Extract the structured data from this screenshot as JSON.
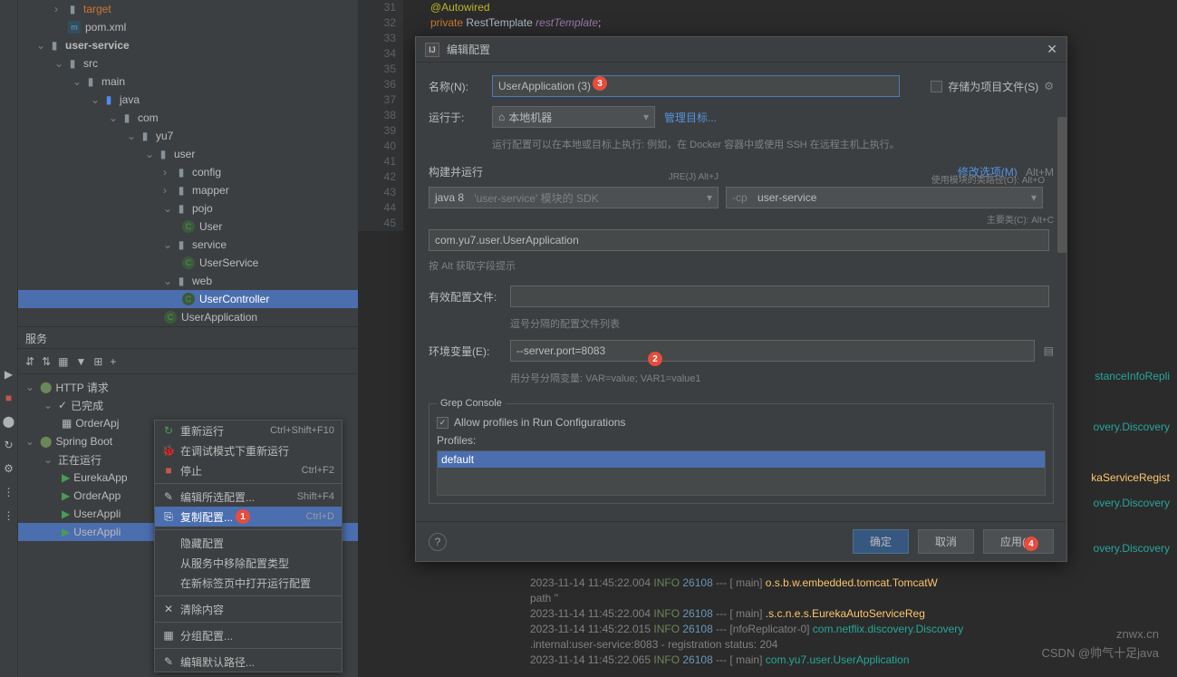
{
  "tree": {
    "target": "target",
    "pom": "pom.xml",
    "userService": "user-service",
    "src": "src",
    "main": "main",
    "java": "java",
    "com": "com",
    "yu7": "yu7",
    "user": "user",
    "config": "config",
    "mapper": "mapper",
    "pojo": "pojo",
    "userClass": "User",
    "service": "service",
    "userServiceClass": "UserService",
    "web": "web",
    "userController": "UserController",
    "userApplication": "UserApplication"
  },
  "servicesPanel": {
    "title": "服务",
    "httpRequests": "HTTP 请求",
    "completed": "已完成",
    "orderApp1": "OrderApj",
    "springBoot": "Spring Boot",
    "running": "正在运行",
    "eurekaApp": "EurekaApp",
    "orderApp2": "OrderApp",
    "userApp1": "UserAppli",
    "userApp2": "UserAppli"
  },
  "contextMenu": {
    "rerun": "重新运行",
    "rerunShortcut": "Ctrl+Shift+F10",
    "debugRerun": "在调试模式下重新运行",
    "stop": "停止",
    "stopShortcut": "Ctrl+F2",
    "editConfig": "编辑所选配置...",
    "editShortcut": "Shift+F4",
    "copyConfig": "复制配置...",
    "copyShortcut": "Ctrl+D",
    "hideConfig": "隐藏配置",
    "removeFromServices": "从服务中移除配置类型",
    "openInNewTab": "在新标签页中打开运行配置",
    "clearContent": "清除内容",
    "groupConfig": "分组配置...",
    "editDefaults": "编辑默认路径..."
  },
  "dialog": {
    "title": "编辑配置",
    "nameLabel": "名称(N):",
    "nameValue": "UserApplication (3)",
    "saveAsProject": "存储为项目文件(S)",
    "runOnLabel": "运行于:",
    "localMachine": "本地机器",
    "manageTargets": "管理目标...",
    "runHint": "运行配置可以在本地或目标上执行: 例如，在 Docker 容器中或使用 SSH 在远程主机上执行。",
    "buildRunSection": "构建并运行",
    "modifyOptions": "修改选项(M)",
    "modifyShortcut": "Alt+M",
    "jreHint": "JRE(J) Alt+J",
    "moduleHint": "使用模块的类路径(O): Alt+O",
    "javaSdk": "java 8",
    "javaSdkHint": "'user-service' 模块的 SDK",
    "cpOption": "-cp",
    "cpModule": "user-service",
    "mainClassHint": "主要类(C): Alt+C",
    "mainClass": "com.yu7.user.UserApplication",
    "altHint": "按 Alt 获取字段提示",
    "activeProfilesLabel": "有效配置文件:",
    "activeProfilesHint": "逗号分隔的配置文件列表",
    "envVarsLabel": "环境变量(E):",
    "envVarsValue": "--server.port=8083",
    "envVarsHint": "用分号分隔变量: VAR=value; VAR1=value1",
    "grepConsole": "Grep Console",
    "allowProfiles": "Allow profiles in Run Configurations",
    "profilesLabel": "Profiles:",
    "profileDefault": "default",
    "ok": "确定",
    "cancel": "取消",
    "apply": "应用(A)"
  },
  "code": {
    "autowired": "@Autowired",
    "private": "private",
    "restTemplate": "RestTemplate",
    "restTemplateVar": "restTemplate",
    "semi": ";"
  },
  "console": {
    "stanceInfo": "stanceInfoRepli",
    "discovery": "overy.Discovery",
    "eurekaReg": "kaServiceRegist",
    "lines": [
      {
        "ts": "2023-11-14 11:45:22.004",
        "lvl": "INFO",
        "pid": "26108",
        "thread": "main",
        "cls": "o.s.b.w.embedded.tomcat.TomcatW",
        "y": true
      },
      {
        "txt": "  path ''"
      },
      {
        "ts": "2023-11-14 11:45:22.004",
        "lvl": "INFO",
        "pid": "26108",
        "thread": "main",
        "cls": ".s.c.n.e.s.EurekaAutoServiceReg",
        "y": true
      },
      {
        "ts": "2023-11-14 11:45:22.015",
        "lvl": "INFO",
        "pid": "26108",
        "thread": "nfoReplicator-0",
        "cls": "com.netflix.discovery.Discovery"
      },
      {
        "txt": ".internal:user-service:8083 - registration status: 204"
      },
      {
        "ts": "2023-11-14 11:45:22.065",
        "lvl": "INFO",
        "pid": "26108",
        "thread": "main",
        "cls": "com.yu7.user.UserApplication"
      }
    ]
  },
  "gutterLines": [
    "31",
    "32",
    "",
    "33",
    "34",
    "35",
    "36",
    "37",
    "38",
    "39",
    "40",
    "41",
    "42",
    "43",
    "44",
    "45"
  ],
  "callouts": {
    "1": "1",
    "2": "2",
    "3": "3",
    "4": "4"
  },
  "watermarks": {
    "znwx": "znwx.cn",
    "csdn": "CSDN @帅气十足java"
  }
}
